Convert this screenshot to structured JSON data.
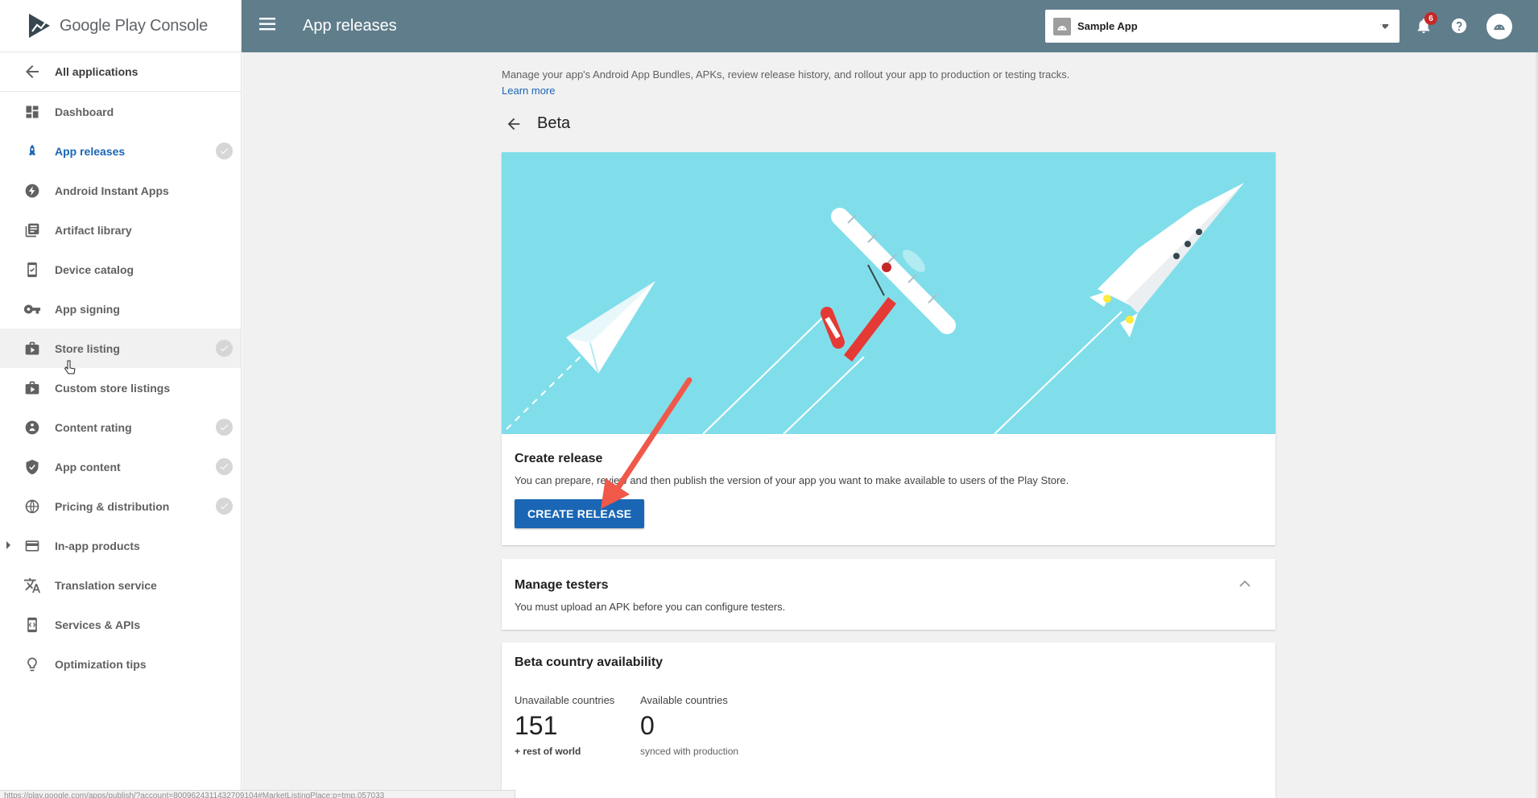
{
  "brand": {
    "logo_text_a": "Google Play",
    "logo_text_b": "Console"
  },
  "sidebar": {
    "back_label": "All applications",
    "items": [
      {
        "label": "Dashboard",
        "icon": "dashboard-icon",
        "checked": false
      },
      {
        "label": "App releases",
        "icon": "rocket-icon",
        "checked": true,
        "active": true
      },
      {
        "label": "Android Instant Apps",
        "icon": "bolt-icon",
        "checked": false
      },
      {
        "label": "Artifact library",
        "icon": "library-icon",
        "checked": false
      },
      {
        "label": "Device catalog",
        "icon": "device-icon",
        "checked": false
      },
      {
        "label": "App signing",
        "icon": "key-icon",
        "checked": false
      },
      {
        "label": "Store listing",
        "icon": "store-icon",
        "checked": true,
        "hover": true
      },
      {
        "label": "Custom store listings",
        "icon": "store-icon",
        "checked": false
      },
      {
        "label": "Content rating",
        "icon": "rating-icon",
        "checked": true
      },
      {
        "label": "App content",
        "icon": "shield-icon",
        "checked": true
      },
      {
        "label": "Pricing & distribution",
        "icon": "globe-icon",
        "checked": true
      },
      {
        "label": "In-app products",
        "icon": "card-icon",
        "checked": false,
        "expandable": true
      },
      {
        "label": "Translation service",
        "icon": "translate-icon",
        "checked": false
      },
      {
        "label": "Services & APIs",
        "icon": "api-icon",
        "checked": false
      },
      {
        "label": "Optimization tips",
        "icon": "bulb-icon",
        "checked": false
      }
    ]
  },
  "topbar": {
    "title": "App releases",
    "app_selector": "Sample App",
    "notification_count": "6"
  },
  "main": {
    "intro": "Manage your app's Android App Bundles, APKs, review release history, and rollout your app to production or testing tracks.",
    "learn_more": "Learn more",
    "track_title": "Beta",
    "create_card": {
      "title": "Create release",
      "text": "You can prepare, review and then publish the version of your app you want to make available to users of the Play Store.",
      "button": "CREATE RELEASE"
    },
    "testers_card": {
      "title": "Manage testers",
      "text": "You must upload an APK before you can configure testers."
    },
    "country_card": {
      "title": "Beta country availability",
      "unavailable_label": "Unavailable countries",
      "unavailable_value": "151",
      "unavailable_sub": "+ rest of world",
      "available_label": "Available countries",
      "available_value": "0",
      "available_sub": "synced with production"
    }
  },
  "status_url": "https://play.google.com/apps/publish/?account=8009624311432709104#MarketListingPlace:p=tmp.057033",
  "colors": {
    "topbar": "#607d8b",
    "accent": "#1a66b5",
    "hero_sky": "#80deea",
    "annotation_arrow": "#f0584a"
  }
}
